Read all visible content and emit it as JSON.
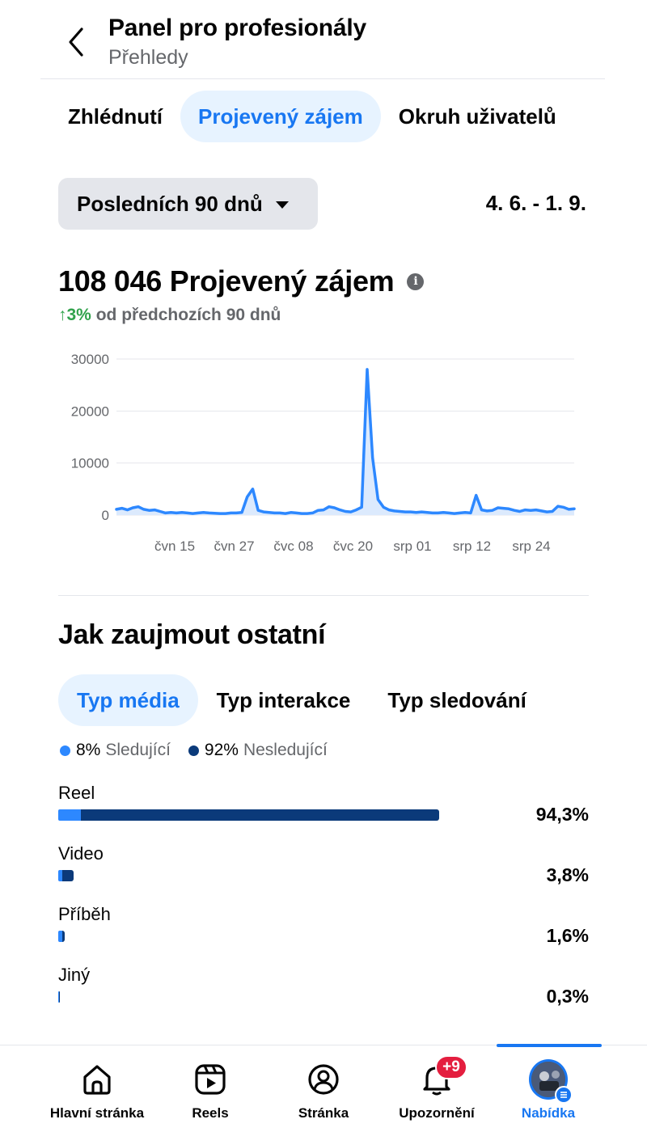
{
  "header": {
    "title": "Panel pro profesionály",
    "subtitle": "Přehledy"
  },
  "tabs": [
    {
      "label": "Zhlédnutí",
      "active": false
    },
    {
      "label": "Projevený zájem",
      "active": true
    },
    {
      "label": "Okruh uživatelů",
      "active": false
    }
  ],
  "range": {
    "selected": "Posledních 90 dnů",
    "dates": "4. 6. - 1. 9."
  },
  "metric": {
    "value_label": "108 046 Projevený zájem",
    "change_value": "↑3%",
    "change_text": "od předchozích 90 dnů"
  },
  "chart_data": {
    "type": "area",
    "title": "",
    "xlabel": "",
    "ylabel": "",
    "ylim": [
      0,
      30000
    ],
    "yticks": [
      "0",
      "10000",
      "20000",
      "30000"
    ],
    "xticks": [
      "čvn 15",
      "čvn 27",
      "čvc 08",
      "čvc 20",
      "srp 01",
      "srp 12",
      "srp 24"
    ],
    "grid": true,
    "color": "#2d88ff",
    "x_start": "4. 6.",
    "x_end": "1. 9.",
    "series": [
      {
        "values": [
          1100,
          1300,
          1000,
          1400,
          1600,
          1100,
          900,
          1000,
          700,
          400,
          500,
          400,
          500,
          400,
          300,
          400,
          500,
          400,
          350,
          300,
          300,
          400,
          400,
          500,
          3500,
          5000,
          900,
          600,
          500,
          400,
          400,
          300,
          500,
          400,
          300,
          300,
          400,
          900,
          1000,
          1600,
          1400,
          1000,
          700,
          600,
          1000,
          1500,
          28000,
          11000,
          3000,
          1500,
          1000,
          800,
          700,
          600,
          600,
          500,
          600,
          500,
          400,
          400,
          500,
          400,
          300,
          400,
          500,
          400,
          3800,
          1000,
          800,
          900,
          1400,
          1300,
          1200,
          900,
          700,
          1000,
          900,
          1000,
          800,
          600,
          700,
          1700,
          1500,
          1100,
          1200
        ]
      }
    ]
  },
  "section2": {
    "title": "Jak zaujmout ostatní",
    "tabs": [
      {
        "label": "Typ média",
        "active": true
      },
      {
        "label": "Typ interakce",
        "active": false
      },
      {
        "label": "Typ sledování",
        "active": false
      }
    ],
    "legend": [
      {
        "pct": "8%",
        "label": "Sledující",
        "color": "#2d88ff"
      },
      {
        "pct": "92%",
        "label": "Nesledující",
        "color": "#0b3a7a"
      }
    ],
    "rows": [
      {
        "label": "Reel",
        "value": "94,3%",
        "share": 0.943,
        "follower_fraction": 0.06
      },
      {
        "label": "Video",
        "value": "3,8%",
        "share": 0.038,
        "follower_fraction": 0.25
      },
      {
        "label": "Příběh",
        "value": "1,6%",
        "share": 0.016,
        "follower_fraction": 0.6
      },
      {
        "label": "Jiný",
        "value": "0,3%",
        "share": 0.003,
        "follower_fraction": 0.5
      }
    ]
  },
  "bottom_nav": [
    {
      "label": "Hlavní stránka",
      "icon": "home-icon",
      "active": false
    },
    {
      "label": "Reels",
      "icon": "reels-icon",
      "active": false
    },
    {
      "label": "Stránka",
      "icon": "profile-icon",
      "active": false
    },
    {
      "label": "Upozornění",
      "icon": "bell-icon",
      "badge": "+9",
      "active": false
    },
    {
      "label": "Nabídka",
      "icon": "menu-avatar-icon",
      "active": true
    }
  ],
  "colors": {
    "accent": "#1877f2",
    "follower": "#2d88ff",
    "non_follower": "#0b3a7a",
    "positive": "#31a24c",
    "badge": "#e41e3f"
  }
}
